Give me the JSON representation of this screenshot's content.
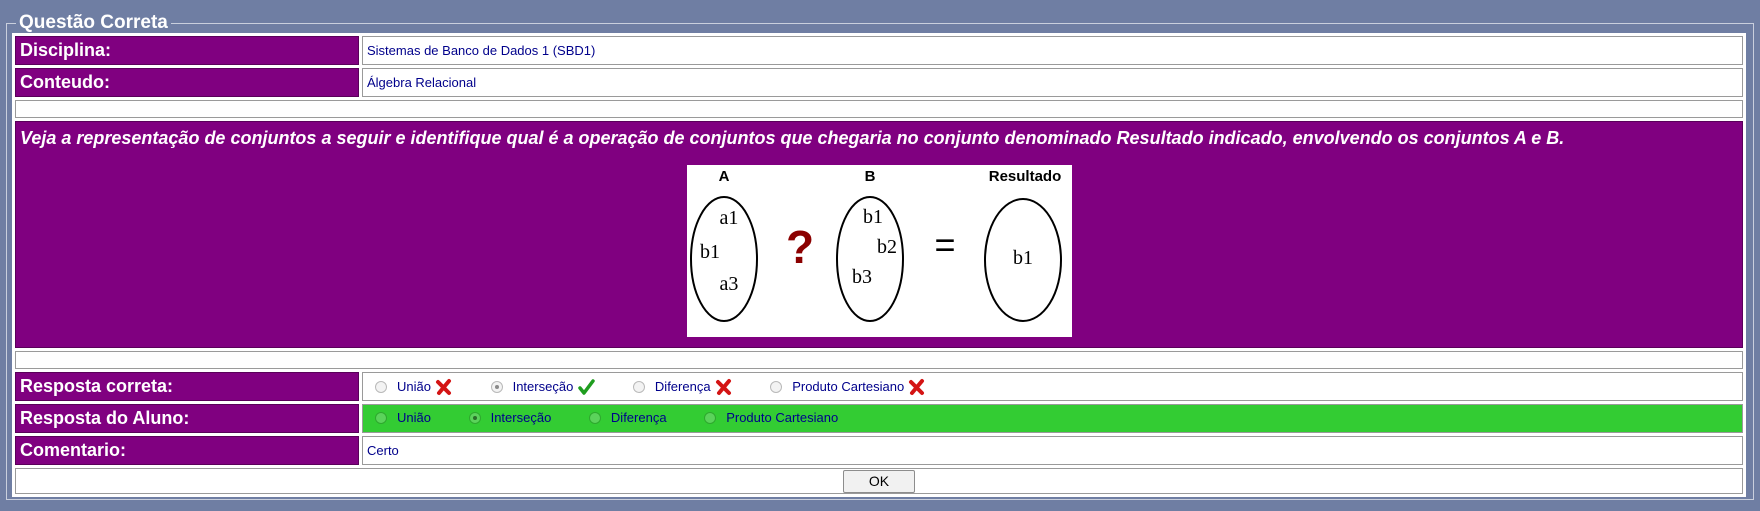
{
  "panel": {
    "legend": "Questão Correta"
  },
  "disciplina": {
    "label": "Disciplina:",
    "value": "Sistemas de Banco de Dados 1 (SBD1)"
  },
  "conteudo": {
    "label": "Conteudo:",
    "value": "Álgebra Relacional"
  },
  "question": {
    "text": "Veja a representação de conjuntos a seguir e identifique qual é a operação de conjuntos que chegaria no conjunto denominado Resultado indicado, envolvendo os conjuntos A e B.",
    "figure": {
      "set_a_label": "A",
      "set_a_items": [
        "a1",
        "b1",
        "a3"
      ],
      "operator": "?",
      "set_b_label": "B",
      "set_b_items": [
        "b1",
        "b2",
        "b3"
      ],
      "equals": "=",
      "result_label": "Resultado",
      "result_items": [
        "b1"
      ]
    }
  },
  "resposta_correta": {
    "label": "Resposta correta:",
    "options": [
      {
        "label": "União",
        "selected": false,
        "mark": "cross"
      },
      {
        "label": "Interseção",
        "selected": true,
        "mark": "check"
      },
      {
        "label": "Diferença",
        "selected": false,
        "mark": "cross"
      },
      {
        "label": "Produto Cartesiano",
        "selected": false,
        "mark": "cross"
      }
    ]
  },
  "resposta_aluno": {
    "label": "Resposta do Aluno:",
    "background": "#33cc33",
    "options": [
      {
        "label": "União",
        "selected": false
      },
      {
        "label": "Interseção",
        "selected": true
      },
      {
        "label": "Diferença",
        "selected": false
      },
      {
        "label": "Produto Cartesiano",
        "selected": false
      }
    ]
  },
  "comentario": {
    "label": "Comentario:",
    "value": "Certo"
  },
  "ok_button": {
    "label": "OK"
  },
  "colors": {
    "label_bg": "#800080",
    "page_bg": "#6f7ea3",
    "correct_bg": "#33cc33",
    "text_blue": "#00008b"
  }
}
